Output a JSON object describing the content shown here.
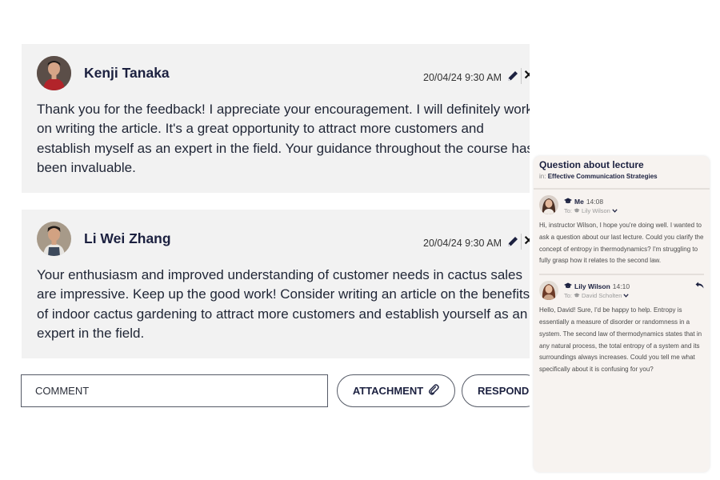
{
  "comments": [
    {
      "author": "Kenji Tanaka",
      "timestamp": "20/04/24 9:30 AM",
      "text": "Thank you for the feedback! I appreciate your encouragement. I will definitely work on writing the article. It's a great opportunity to attract more customers and establish myself as an expert in the field. Your guidance throughout the course has been invaluable."
    },
    {
      "author": "Li Wei Zhang",
      "timestamp": "20/04/24 9:30 AM",
      "text": "Your enthusiasm and improved understanding of customer needs in cactus sales are impressive. Keep up the good work! Consider writing an article on  the benefits of indoor cactus gardening to attract more customers and establish yourself as an expert in the field."
    }
  ],
  "comment_box": {
    "placeholder": "COMMENT",
    "attachment_label": "ATTACHMENT",
    "respond_label": "RESPOND"
  },
  "message_thread": {
    "title": "Question about lecture",
    "in_label": "in:",
    "course": "Effective Communication Strategies",
    "messages": [
      {
        "sender": "Me",
        "time": "14:08",
        "to_label": "To:",
        "recipient": "Lily Wilson",
        "text": "Hi, instructor Wilson, I hope you're doing well. I wanted to ask a question about our last lecture. Could you clarify the concept of entropy in thermodynamics? I'm struggling to fully grasp how it relates to the second law."
      },
      {
        "sender": "Lily Wilson",
        "time": "14:10",
        "to_label": "To:",
        "recipient": "David Scholten",
        "text": "Hello, David! Sure, I'd be happy to help. Entropy is essentially a measure of disorder or randomness in a system. The second law of thermodynamics states that in any natural process, the total entropy of a system and its surroundings always increases. Could you tell me what specifically about it is confusing for you?"
      }
    ]
  },
  "colors": {
    "card_bg": "#f2f2f2",
    "panel_bg": "#f7f3f0",
    "navy_text": "#1c2140"
  },
  "icons": [
    "pencil-icon",
    "close-icon",
    "paperclip-icon",
    "graduation-cap-icon",
    "chevron-down-icon",
    "reply-icon"
  ]
}
